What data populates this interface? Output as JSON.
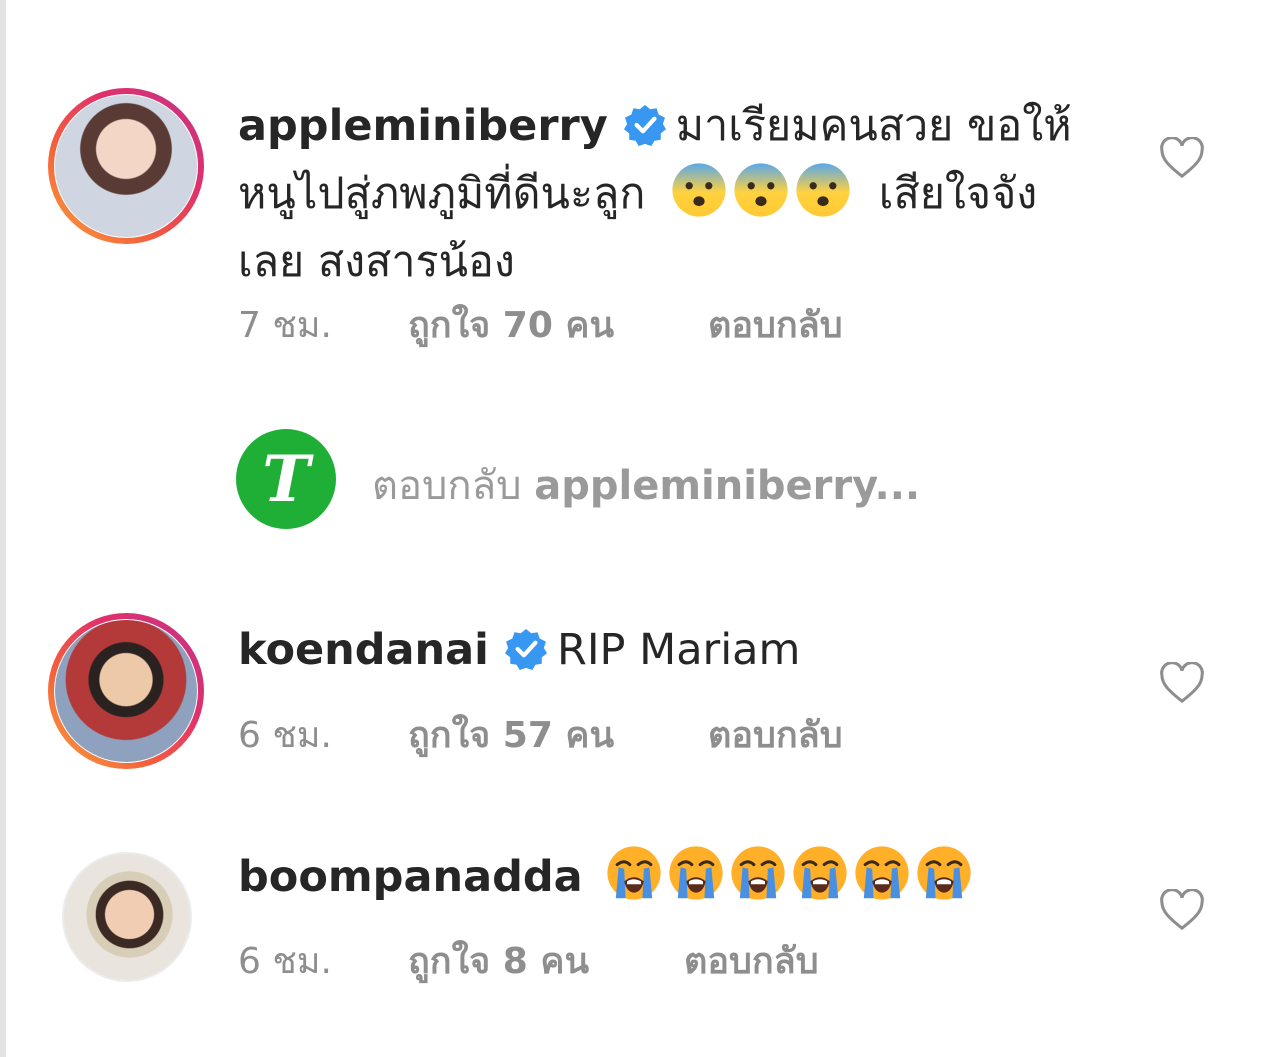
{
  "comments": [
    {
      "username": "appleminiberry",
      "verified": true,
      "text_line1": "มาเรียมคนสวย ขอให้",
      "text_line2": "หนูไปสู่ภพภูมิที่ดีนะลูก",
      "text_line2_after": "เสียใจจัง",
      "text_line3": "เลย สงสารน้อง",
      "emoji": "fearful-face",
      "time": "7 ชม.",
      "likes": "ถูกใจ 70 คน",
      "reply": "ตอบกลับ"
    },
    {
      "username": "koendanai",
      "verified": true,
      "text": "RIP Mariam",
      "time": "6 ชม.",
      "likes": "ถูกใจ 57 คน",
      "reply": "ตอบกลับ"
    },
    {
      "username": "boompanadda",
      "verified": false,
      "emoji": "loudly-crying-face",
      "emoji_count": 6,
      "time": "6 ชม.",
      "likes": "ถูกใจ 8 คน",
      "reply": "ตอบกลับ"
    }
  ],
  "view_replies": {
    "label": "ตอบกลับ",
    "target": "appleminiberry...",
    "avatar_letter": "T"
  },
  "colors": {
    "text": "#262626",
    "meta": "#8e8e8e",
    "verified_blue": "#3897f0",
    "reply_avatar_green": "#1fae36"
  }
}
